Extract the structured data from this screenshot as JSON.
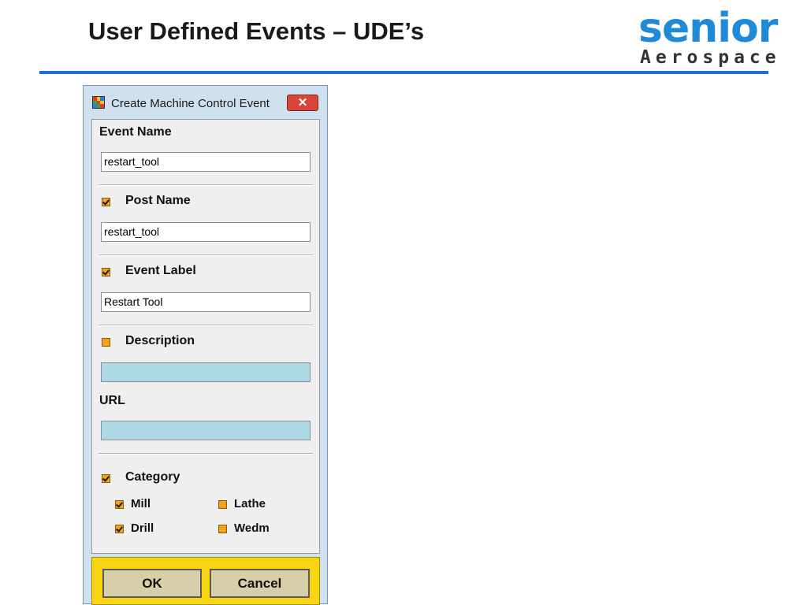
{
  "slide": {
    "title": "User Defined Events – UDE’s"
  },
  "logo": {
    "word": "senior",
    "sub": "Aerospace"
  },
  "dialog": {
    "title": "Create Machine Control Event",
    "close_label": "✕",
    "event_name": {
      "label": "Event Name",
      "value": "restart_tool"
    },
    "post_name": {
      "label": "Post Name",
      "checked": true,
      "value": "restart_tool"
    },
    "event_label": {
      "label": "Event Label",
      "checked": true,
      "value": "Restart Tool"
    },
    "description": {
      "label": "Description",
      "checked": false,
      "value": ""
    },
    "url": {
      "label": "URL",
      "value": ""
    },
    "category": {
      "label": "Category",
      "checked": true,
      "options": [
        {
          "label": "Mill",
          "checked": true
        },
        {
          "label": "Lathe",
          "checked": false
        },
        {
          "label": "Drill",
          "checked": true
        },
        {
          "label": "Wedm",
          "checked": false
        }
      ]
    },
    "ok_label": "OK",
    "cancel_label": "Cancel"
  },
  "colors": {
    "accent_rule": "#1f6fd1",
    "checkbox": "#f3a21a",
    "footer": "#f8d511",
    "empty_field": "#add8e6"
  }
}
